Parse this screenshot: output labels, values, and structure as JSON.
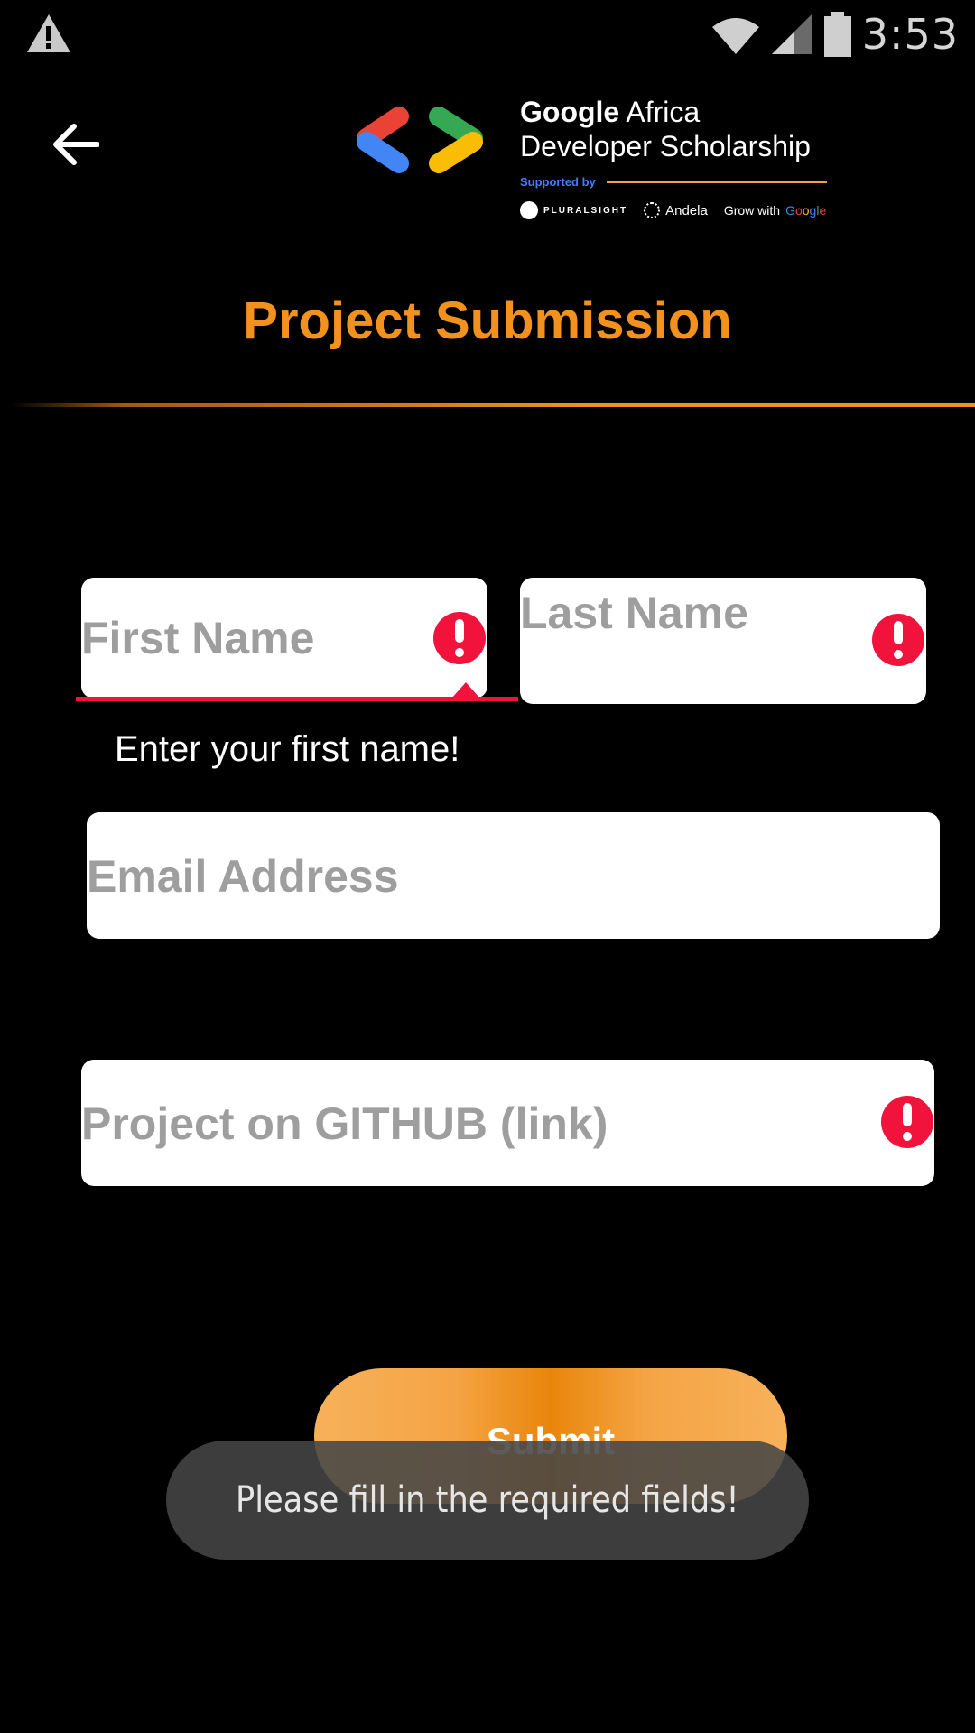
{
  "status_bar": {
    "time": "3:53",
    "icons": [
      "warning-icon",
      "wifi-icon",
      "cell-signal-icon",
      "battery-icon"
    ]
  },
  "app_bar": {
    "back_icon": "arrow-left-icon",
    "brand": {
      "line1_bold": "Google",
      "line1_rest": " Africa",
      "line2": "Developer Scholarship",
      "supported_by": "Supported by",
      "partners": {
        "pluralsight": "PLURALSIGHT",
        "andela": "Andela",
        "grow_with": "Grow with",
        "google_letters": [
          "G",
          "o",
          "o",
          "g",
          "l",
          "e"
        ]
      },
      "colors": {
        "red": "#ea4335",
        "blue": "#4285f4",
        "yellow": "#fbbc05",
        "green": "#34a853"
      }
    }
  },
  "page": {
    "title": "Project Submission",
    "accent_color": "#f2911e"
  },
  "form": {
    "first_name": {
      "placeholder": "First Name",
      "error": true,
      "helper": "Enter your first name!"
    },
    "last_name": {
      "placeholder": "Last Name",
      "error": true
    },
    "email": {
      "placeholder": "Email Address",
      "error": false
    },
    "github": {
      "placeholder": "Project on GITHUB (link)",
      "error": true
    },
    "error_color": "#f2133c",
    "submit_label": "Submit"
  },
  "toast": {
    "message": "Please fill in the required fields!"
  }
}
